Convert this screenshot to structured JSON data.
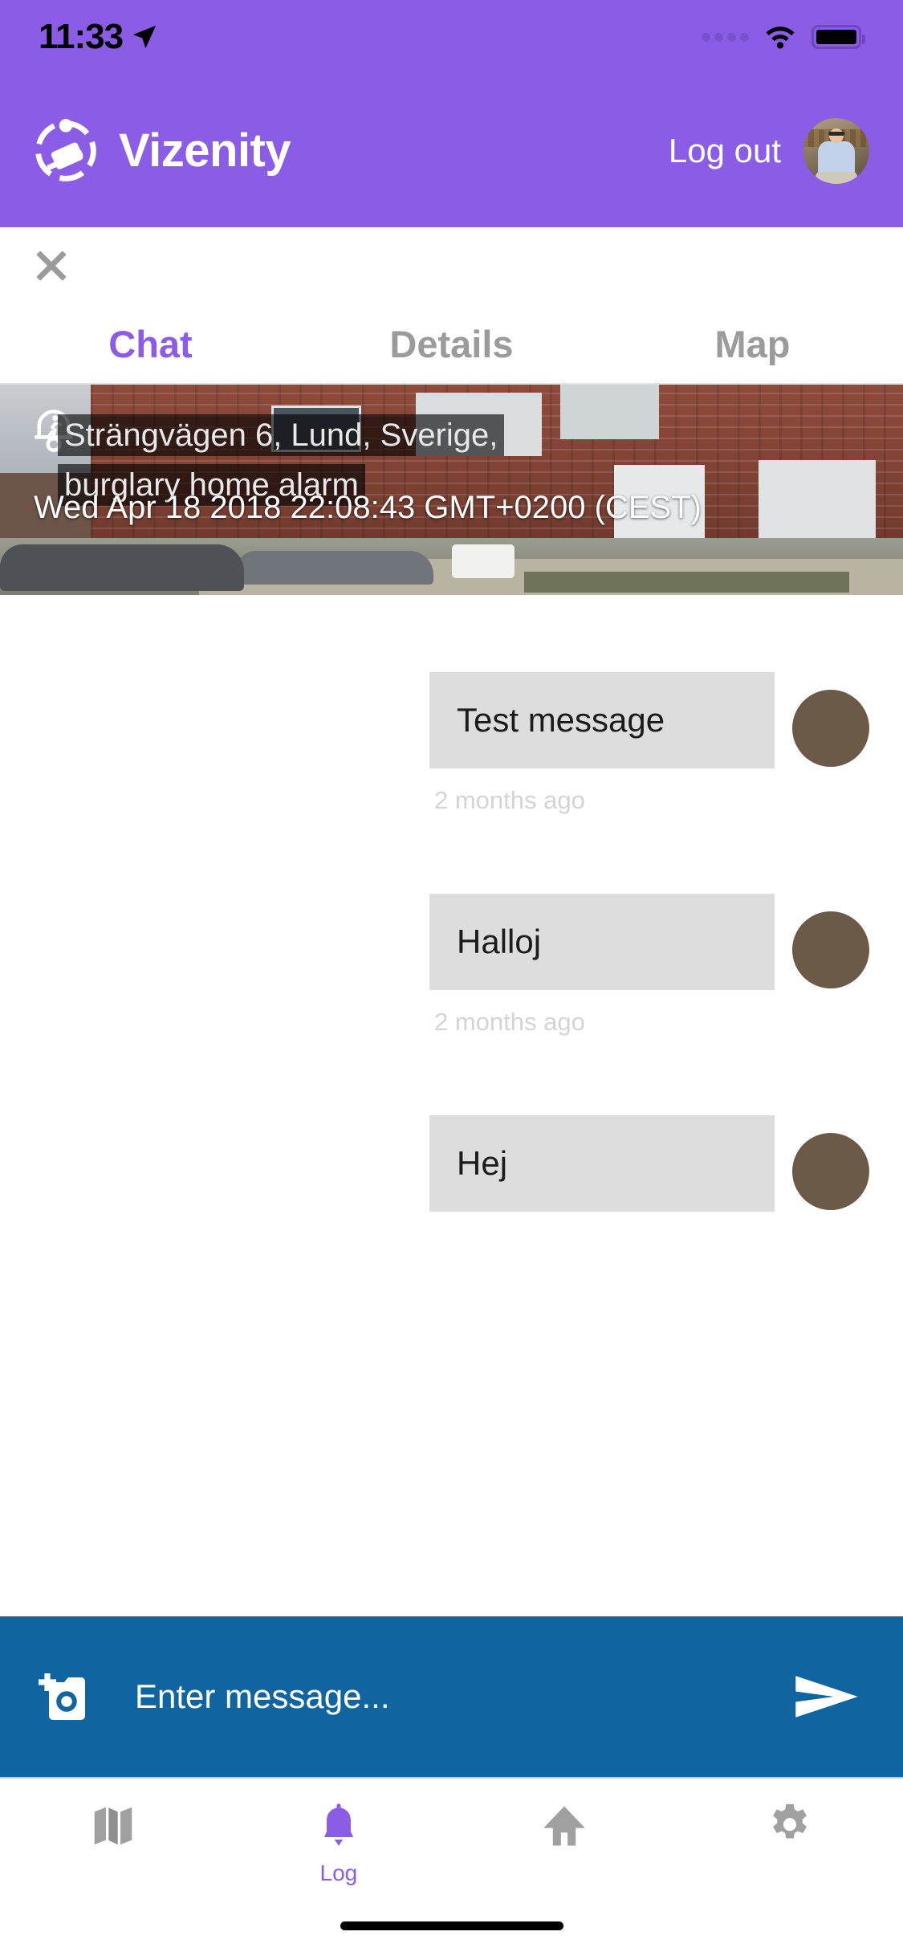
{
  "status_bar": {
    "time": "11:33",
    "location_icon": "location-arrow-icon",
    "wifi_icon": "wifi-icon",
    "battery_icon": "battery-icon"
  },
  "header": {
    "logo_icon": "vizenity-camera-badge-logo",
    "app_name": "Vizenity",
    "logout_label": "Log out",
    "avatar_name": "user-avatar",
    "background_color": "#8B5CE6"
  },
  "close_button": {
    "icon": "close-icon"
  },
  "tabs": [
    {
      "label": "Chat",
      "active": true
    },
    {
      "label": "Details",
      "active": false
    },
    {
      "label": "Map",
      "active": false
    }
  ],
  "banner": {
    "alarm_icon": "burglar-alarm-running-person-icon",
    "address_line1": "Strängvägen 6, Lund, Sverige,",
    "address_line2": "burglary home alarm",
    "timestamp": "Wed Apr 18 2018 22:08:43 GMT+0200 (CEST)"
  },
  "messages": [
    {
      "text": "Test message",
      "time": "2 months ago",
      "avatar": "user-avatar"
    },
    {
      "text": "Halloj",
      "time": "2 months ago",
      "avatar": "user-avatar"
    },
    {
      "text": "Hej",
      "time": "",
      "avatar": "user-avatar"
    }
  ],
  "input_bar": {
    "camera_icon": "camera-add-icon",
    "placeholder": "Enter message...",
    "value": "",
    "send_icon": "send-icon",
    "background_color": "#1065A0"
  },
  "bottom_nav": [
    {
      "icon": "map-icon",
      "label": "",
      "active": false
    },
    {
      "icon": "bell-icon",
      "label": "Log",
      "active": true
    },
    {
      "icon": "home-icon",
      "label": "",
      "active": false
    },
    {
      "icon": "gear-icon",
      "label": "",
      "active": false
    }
  ],
  "colors": {
    "brand_purple": "#8B5CE6",
    "input_blue": "#1065A0",
    "bubble_gray": "#DDDDDD",
    "inactive_gray": "#9B9B9B"
  }
}
